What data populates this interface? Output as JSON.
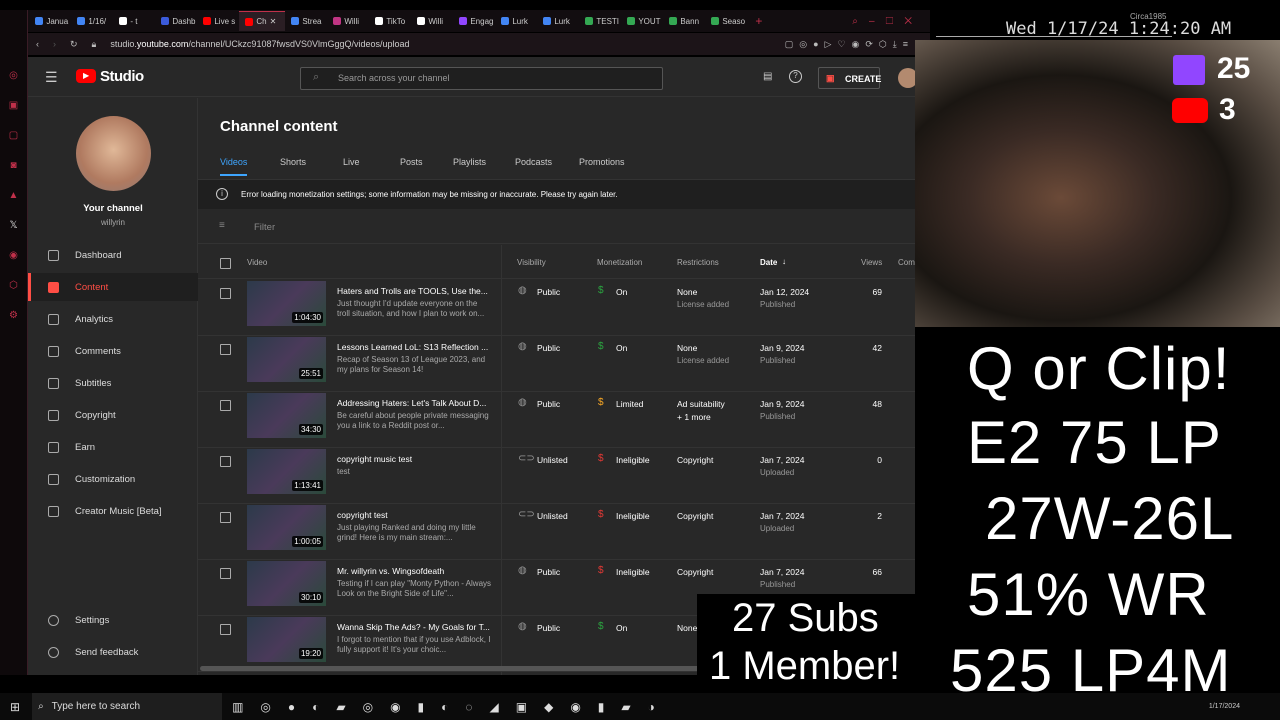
{
  "browser": {
    "tabs": [
      "Janua",
      "1/16/",
      "- t",
      "Dashb",
      "Live s",
      "Ch",
      "Strea",
      "Willi",
      "TikTo",
      "Willi",
      "Engag",
      "Lurk",
      "Lurk",
      "TESTI",
      "YOUT",
      "Bann",
      "Seaso"
    ],
    "active_tab": 5,
    "url_prefix": "studio.",
    "url_host": "youtube.com",
    "url_path": "/channel/UCkzc91087fwsdVS0VlmGggQ/videos/upload"
  },
  "studio": {
    "logo": "Studio",
    "search_placeholder": "Search across your channel",
    "create_label": "CREATE",
    "channel_label": "Your channel",
    "channel_handle": "willyrin",
    "nav": [
      "Dashboard",
      "Content",
      "Analytics",
      "Comments",
      "Subtitles",
      "Copyright",
      "Earn",
      "Customization",
      "Creator Music [Beta]"
    ],
    "active_nav": 1,
    "bottom_nav": [
      "Settings",
      "Send feedback"
    ],
    "page_title": "Channel content",
    "tabs": [
      "Videos",
      "Shorts",
      "Live",
      "Posts",
      "Playlists",
      "Podcasts",
      "Promotions"
    ],
    "active_tab": 0,
    "error_banner": "Error loading monetization settings; some information may be missing or inaccurate. Please try again later.",
    "filter_placeholder": "Filter",
    "columns": {
      "video": "Video",
      "visibility": "Visibility",
      "monetization": "Monetization",
      "restrictions": "Restrictions",
      "date": "Date",
      "views": "Views",
      "comments": "Comm"
    },
    "videos": [
      {
        "title": "Haters and Trolls are TOOLS, Use the...",
        "desc": "Just thought I'd update everyone on the troll situation, and how I plan to work on...",
        "duration": "1:04:30",
        "visibility": "Public",
        "monetization": "On",
        "restriction": "None",
        "restriction_sub": "License added",
        "date": "Jan 12, 2024",
        "status": "Published",
        "views": "69"
      },
      {
        "title": "Lessons Learned LoL: S13 Reflection ...",
        "desc": "Recap of Season 13 of League 2023, and my plans for Season 14!",
        "duration": "25:51",
        "visibility": "Public",
        "monetization": "On",
        "restriction": "None",
        "restriction_sub": "License added",
        "date": "Jan 9, 2024",
        "status": "Published",
        "views": "42"
      },
      {
        "title": "Addressing Haters: Let's Talk About D...",
        "desc": "Be careful about people private messaging you a link to a Reddit post or...",
        "duration": "34:30",
        "visibility": "Public",
        "monetization": "Limited",
        "restriction": "Ad suitability",
        "restriction_sub": "+ 1 more",
        "date": "Jan 9, 2024",
        "status": "Published",
        "views": "48"
      },
      {
        "title": "copyright music test",
        "desc": "test",
        "duration": "1:13:41",
        "visibility": "Unlisted",
        "monetization": "Ineligible",
        "restriction": "Copyright",
        "restriction_sub": "",
        "date": "Jan 7, 2024",
        "status": "Uploaded",
        "views": "0"
      },
      {
        "title": "copyright test",
        "desc": "Just playing Ranked and doing my little grind! Here is my main stream:...",
        "duration": "1:00:05",
        "visibility": "Unlisted",
        "monetization": "Ineligible",
        "restriction": "Copyright",
        "restriction_sub": "",
        "date": "Jan 7, 2024",
        "status": "Uploaded",
        "views": "2"
      },
      {
        "title": "Mr. willyrin vs. Wingsofdeath",
        "desc": "Testing if I can play \"Monty Python - Always Look on the Bright Side of Life\"...",
        "duration": "30:10",
        "visibility": "Public",
        "monetization": "Ineligible",
        "restriction": "Copyright",
        "restriction_sub": "",
        "date": "Jan 7, 2024",
        "status": "Published",
        "views": "66"
      },
      {
        "title": "Wanna Skip The Ads? - My Goals for T...",
        "desc": "I forgot to mention that if you use Adblock, I fully support it! It's your choic...",
        "duration": "19:20",
        "visibility": "Public",
        "monetization": "On",
        "restriction": "None",
        "restriction_sub": "",
        "date": "",
        "status": "",
        "views": ""
      }
    ]
  },
  "stream": {
    "clock": "Wed 1/17/24 1:24:20 AM",
    "watermark": "Circa1985",
    "twitch_viewers": "25",
    "youtube_viewers": "3",
    "lines": [
      "Q or Clip!",
      "E2 75 LP",
      "27W-26L",
      "51% WR",
      "525 LP4M"
    ],
    "subs": "27 Subs",
    "members": "1 Member!"
  },
  "taskbar": {
    "search_placeholder": "Type here to search",
    "date": "1/17/2024"
  },
  "colors": {
    "accent": "#ff4e45",
    "tab_active": "#3ea6ff",
    "money_on": "#2ba640",
    "money_limited": "#f9a825",
    "money_ineligible": "#e53935",
    "twitch": "#9146ff",
    "youtube": "#ff0000"
  }
}
